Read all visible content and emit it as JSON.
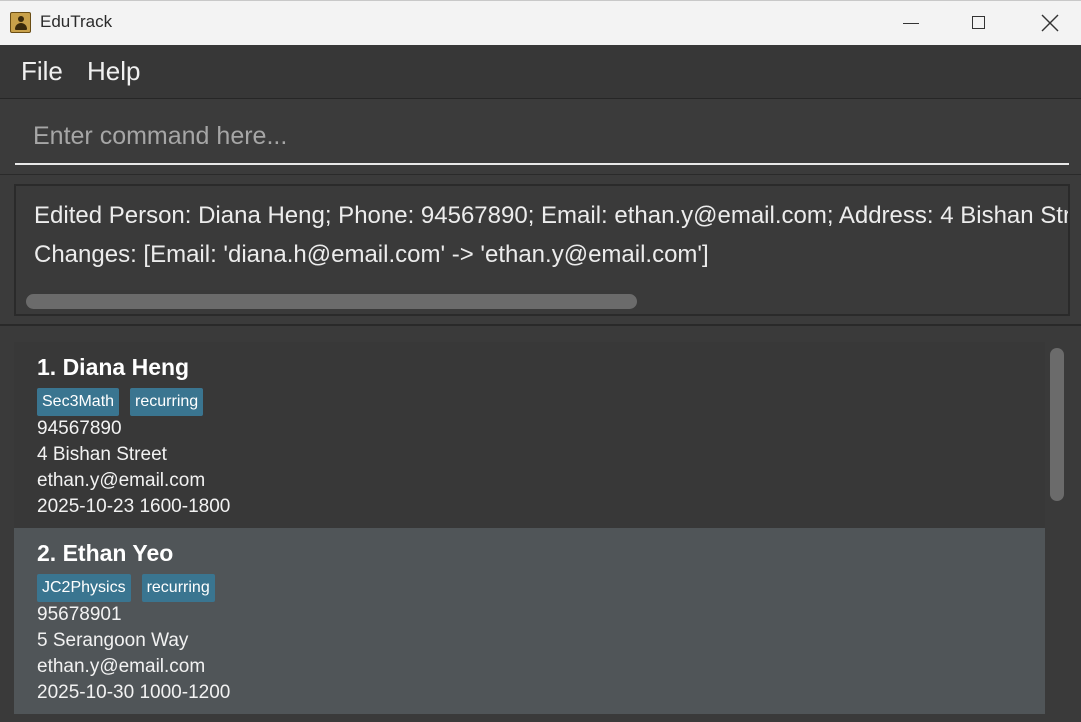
{
  "window": {
    "title": "EduTrack",
    "icon": "address-book-icon"
  },
  "menu": {
    "file_label": "File",
    "help_label": "Help"
  },
  "command": {
    "placeholder": "Enter command here...",
    "value": ""
  },
  "result": {
    "line1": "Edited Person: Diana Heng; Phone: 94567890; Email: ethan.y@email.com; Address: 4 Bishan Str",
    "line2": "Changes: [Email: 'diana.h@email.com' -> 'ethan.y@email.com']"
  },
  "persons": [
    {
      "name": "1. Diana Heng",
      "tags": [
        "Sec3Math",
        "recurring"
      ],
      "phone": "94567890",
      "address": "4 Bishan Street",
      "email": "ethan.y@email.com",
      "schedule": "2025-10-23 1600-1800"
    },
    {
      "name": "2. Ethan Yeo",
      "tags": [
        "JC2Physics",
        "recurring"
      ],
      "phone": "95678901",
      "address": "5 Serangoon Way",
      "email": "ethan.y@email.com",
      "schedule": "2025-10-30 1000-1200"
    }
  ],
  "colors": {
    "tag": "#3a7590",
    "selected_card": "#505558",
    "background": "#3a3a3a"
  }
}
